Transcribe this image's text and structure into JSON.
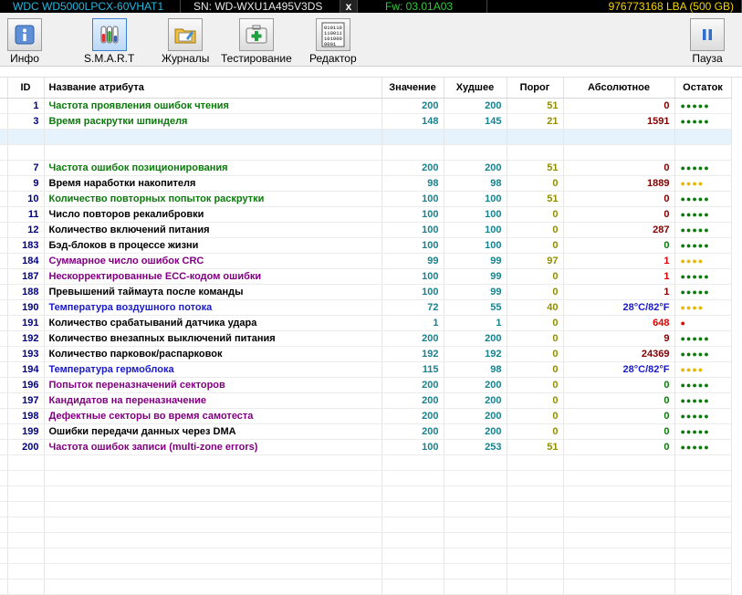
{
  "topbar": {
    "model": "WDC WD5000LPCX-60VHAT1",
    "serial": "SN: WD-WXU1A495V3DS",
    "close": "x",
    "firmware": "Fw: 03.01A03",
    "lba": "976773168 LBA (500 GB)"
  },
  "toolbar": {
    "info": "Инфо",
    "smart": "S.M.A.R.T",
    "logs": "Журналы",
    "test": "Тестирование",
    "editor": "Редактор",
    "pause": "Пауза"
  },
  "table": {
    "headers": {
      "id": "ID",
      "name": "Название атрибута",
      "value": "Значение",
      "worst": "Худшее",
      "threshold": "Порог",
      "raw": "Абсолютное",
      "remain": "Остаток"
    },
    "rows": [
      {
        "id": "1",
        "name": "Частота проявления ошибок чтения",
        "value": "200",
        "worst": "200",
        "threshold": "51",
        "raw": "0",
        "dots": 5,
        "name_color": "#0a7a0a",
        "raw_color": "#800000",
        "dot_color": "#0a7a0a",
        "selected": false
      },
      {
        "id": "3",
        "name": "Время раскрутки шпинделя",
        "value": "148",
        "worst": "145",
        "threshold": "21",
        "raw": "1591",
        "dots": 5,
        "name_color": "#0a7a0a",
        "raw_color": "#800000",
        "dot_color": "#0a7a0a",
        "selected": false
      },
      {
        "id": "",
        "name": "",
        "value": "",
        "worst": "",
        "threshold": "",
        "raw": "",
        "dots": 0,
        "name_color": "#000000",
        "raw_color": "#000000",
        "dot_color": "#000000",
        "selected": true
      },
      {
        "id": "",
        "name": "",
        "value": "",
        "worst": "",
        "threshold": "",
        "raw": "",
        "dots": 0,
        "name_color": "#000000",
        "raw_color": "#000000",
        "dot_color": "#000000",
        "selected": false
      },
      {
        "id": "7",
        "name": "Частота ошибок позиционирования",
        "value": "200",
        "worst": "200",
        "threshold": "51",
        "raw": "0",
        "dots": 5,
        "name_color": "#0a7a0a",
        "raw_color": "#800000",
        "dot_color": "#0a7a0a",
        "selected": false
      },
      {
        "id": "9",
        "name": "Время наработки накопителя",
        "value": "98",
        "worst": "98",
        "threshold": "0",
        "raw": "1889",
        "dots": 4,
        "name_color": "#000000",
        "raw_color": "#800000",
        "dot_color": "#e8b800",
        "selected": false
      },
      {
        "id": "10",
        "name": "Количество повторных попыток раскрутки",
        "value": "100",
        "worst": "100",
        "threshold": "51",
        "raw": "0",
        "dots": 5,
        "name_color": "#0a7a0a",
        "raw_color": "#800000",
        "dot_color": "#0a7a0a",
        "selected": false
      },
      {
        "id": "11",
        "name": "Число повторов рекалибровки",
        "value": "100",
        "worst": "100",
        "threshold": "0",
        "raw": "0",
        "dots": 5,
        "name_color": "#000000",
        "raw_color": "#800000",
        "dot_color": "#0a7a0a",
        "selected": false
      },
      {
        "id": "12",
        "name": "Количество включений питания",
        "value": "100",
        "worst": "100",
        "threshold": "0",
        "raw": "287",
        "dots": 5,
        "name_color": "#000000",
        "raw_color": "#800000",
        "dot_color": "#0a7a0a",
        "selected": false
      },
      {
        "id": "183",
        "name": "Бэд-блоков в процессе жизни",
        "value": "100",
        "worst": "100",
        "threshold": "0",
        "raw": "0",
        "dots": 5,
        "name_color": "#000000",
        "raw_color": "#0a7a0a",
        "dot_color": "#0a7a0a",
        "selected": false
      },
      {
        "id": "184",
        "name": "Суммарное число ошибок CRC",
        "value": "99",
        "worst": "99",
        "threshold": "97",
        "raw": "1",
        "dots": 4,
        "name_color": "#800080",
        "raw_color": "#e00000",
        "dot_color": "#e8b800",
        "selected": false
      },
      {
        "id": "187",
        "name": "Нескорректированные ECC-кодом ошибки",
        "value": "100",
        "worst": "99",
        "threshold": "0",
        "raw": "1",
        "dots": 5,
        "name_color": "#800080",
        "raw_color": "#e00000",
        "dot_color": "#0a7a0a",
        "selected": false
      },
      {
        "id": "188",
        "name": "Превышений таймаута после команды",
        "value": "100",
        "worst": "99",
        "threshold": "0",
        "raw": "1",
        "dots": 5,
        "name_color": "#000000",
        "raw_color": "#800000",
        "dot_color": "#0a7a0a",
        "selected": false
      },
      {
        "id": "190",
        "name": "Температура воздушного потока",
        "value": "72",
        "worst": "55",
        "threshold": "40",
        "raw": "28°C/82°F",
        "dots": 4,
        "name_color": "#1a1ac8",
        "raw_color": "#1a1ac8",
        "dot_color": "#e8b800",
        "selected": false
      },
      {
        "id": "191",
        "name": "Количество срабатываний датчика удара",
        "value": "1",
        "worst": "1",
        "threshold": "0",
        "raw": "648",
        "dots": 1,
        "name_color": "#000000",
        "raw_color": "#e00000",
        "dot_color": "#e00000",
        "selected": false
      },
      {
        "id": "192",
        "name": "Количество внезапных выключений питания",
        "value": "200",
        "worst": "200",
        "threshold": "0",
        "raw": "9",
        "dots": 5,
        "name_color": "#000000",
        "raw_color": "#800000",
        "dot_color": "#0a7a0a",
        "selected": false
      },
      {
        "id": "193",
        "name": "Количество парковок/распарковок",
        "value": "192",
        "worst": "192",
        "threshold": "0",
        "raw": "24369",
        "dots": 5,
        "name_color": "#000000",
        "raw_color": "#800000",
        "dot_color": "#0a7a0a",
        "selected": false
      },
      {
        "id": "194",
        "name": "Температура гермоблока",
        "value": "115",
        "worst": "98",
        "threshold": "0",
        "raw": "28°C/82°F",
        "dots": 4,
        "name_color": "#1a1ac8",
        "raw_color": "#1a1ac8",
        "dot_color": "#e8b800",
        "selected": false
      },
      {
        "id": "196",
        "name": "Попыток переназначений секторов",
        "value": "200",
        "worst": "200",
        "threshold": "0",
        "raw": "0",
        "dots": 5,
        "name_color": "#800080",
        "raw_color": "#0a7a0a",
        "dot_color": "#0a7a0a",
        "selected": false
      },
      {
        "id": "197",
        "name": "Кандидатов на переназначение",
        "value": "200",
        "worst": "200",
        "threshold": "0",
        "raw": "0",
        "dots": 5,
        "name_color": "#800080",
        "raw_color": "#0a7a0a",
        "dot_color": "#0a7a0a",
        "selected": false
      },
      {
        "id": "198",
        "name": "Дефектные секторы во время самотеста",
        "value": "200",
        "worst": "200",
        "threshold": "0",
        "raw": "0",
        "dots": 5,
        "name_color": "#800080",
        "raw_color": "#0a7a0a",
        "dot_color": "#0a7a0a",
        "selected": false
      },
      {
        "id": "199",
        "name": "Ошибки передачи данных через DMA",
        "value": "200",
        "worst": "200",
        "threshold": "0",
        "raw": "0",
        "dots": 5,
        "name_color": "#000000",
        "raw_color": "#0a7a0a",
        "dot_color": "#0a7a0a",
        "selected": false
      },
      {
        "id": "200",
        "name": "Частота ошибок записи (multi-zone errors)",
        "value": "100",
        "worst": "253",
        "threshold": "51",
        "raw": "0",
        "dots": 5,
        "name_color": "#800080",
        "raw_color": "#0a7a0a",
        "dot_color": "#0a7a0a",
        "selected": false
      }
    ],
    "empty_rows": 9
  }
}
